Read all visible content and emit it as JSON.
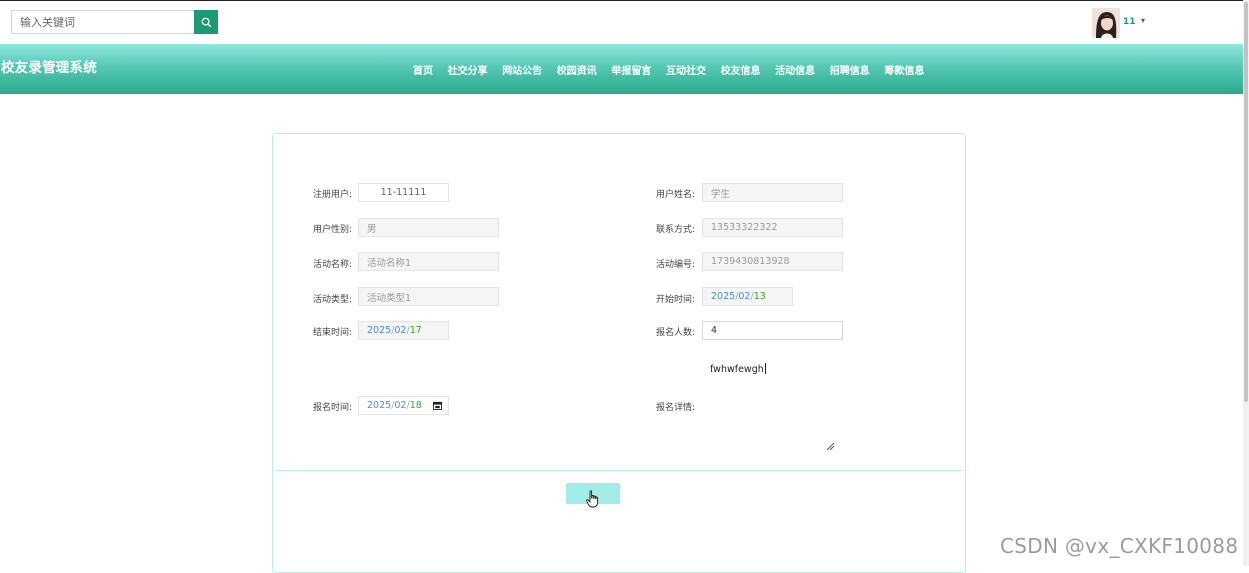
{
  "search": {
    "placeholder": "输入关键词"
  },
  "user": {
    "name": "11"
  },
  "brand": "校友录管理系统",
  "nav": [
    "首页",
    "社交分享",
    "网站公告",
    "校园资讯",
    "举报留言",
    "互动社交",
    "校友信息",
    "活动信息",
    "招聘信息",
    "筹款信息"
  ],
  "form": {
    "reg_user_label": "注册用户:",
    "reg_user_value": "11-11111",
    "user_name_label": "用户姓名:",
    "user_name_value": "学生",
    "gender_label": "用户性别:",
    "gender_value": "男",
    "contact_label": "联系方式:",
    "contact_value": "13533322322",
    "activity_name_label": "活动名称:",
    "activity_name_value": "活动名称1",
    "activity_no_label": "活动编号:",
    "activity_no_value": "1739430813928",
    "activity_type_label": "活动类型:",
    "activity_type_value": "活动类型1",
    "start_label": "开始时间:",
    "start_value": {
      "y": "2025",
      "m": "02",
      "d": "13"
    },
    "end_label": "结束时间:",
    "end_value": {
      "y": "2025",
      "m": "02",
      "d": "17"
    },
    "count_label": "报名人数:",
    "count_value": "4",
    "signup_time_label": "报名时间:",
    "signup_time_value": {
      "y": "2025",
      "m": "02",
      "d": "18"
    },
    "detail_label": "报名详情:",
    "detail_value": "fwhwfewgh",
    "submit_label": ""
  },
  "watermark": "CSDN @vx_CXKF10088",
  "colors": {
    "accent": "#1a9b73",
    "nav_top": "#8fe7dd",
    "nav_bottom": "#2aa98a",
    "card_border": "#b9eeea",
    "submit_bg": "#a0ece6"
  }
}
